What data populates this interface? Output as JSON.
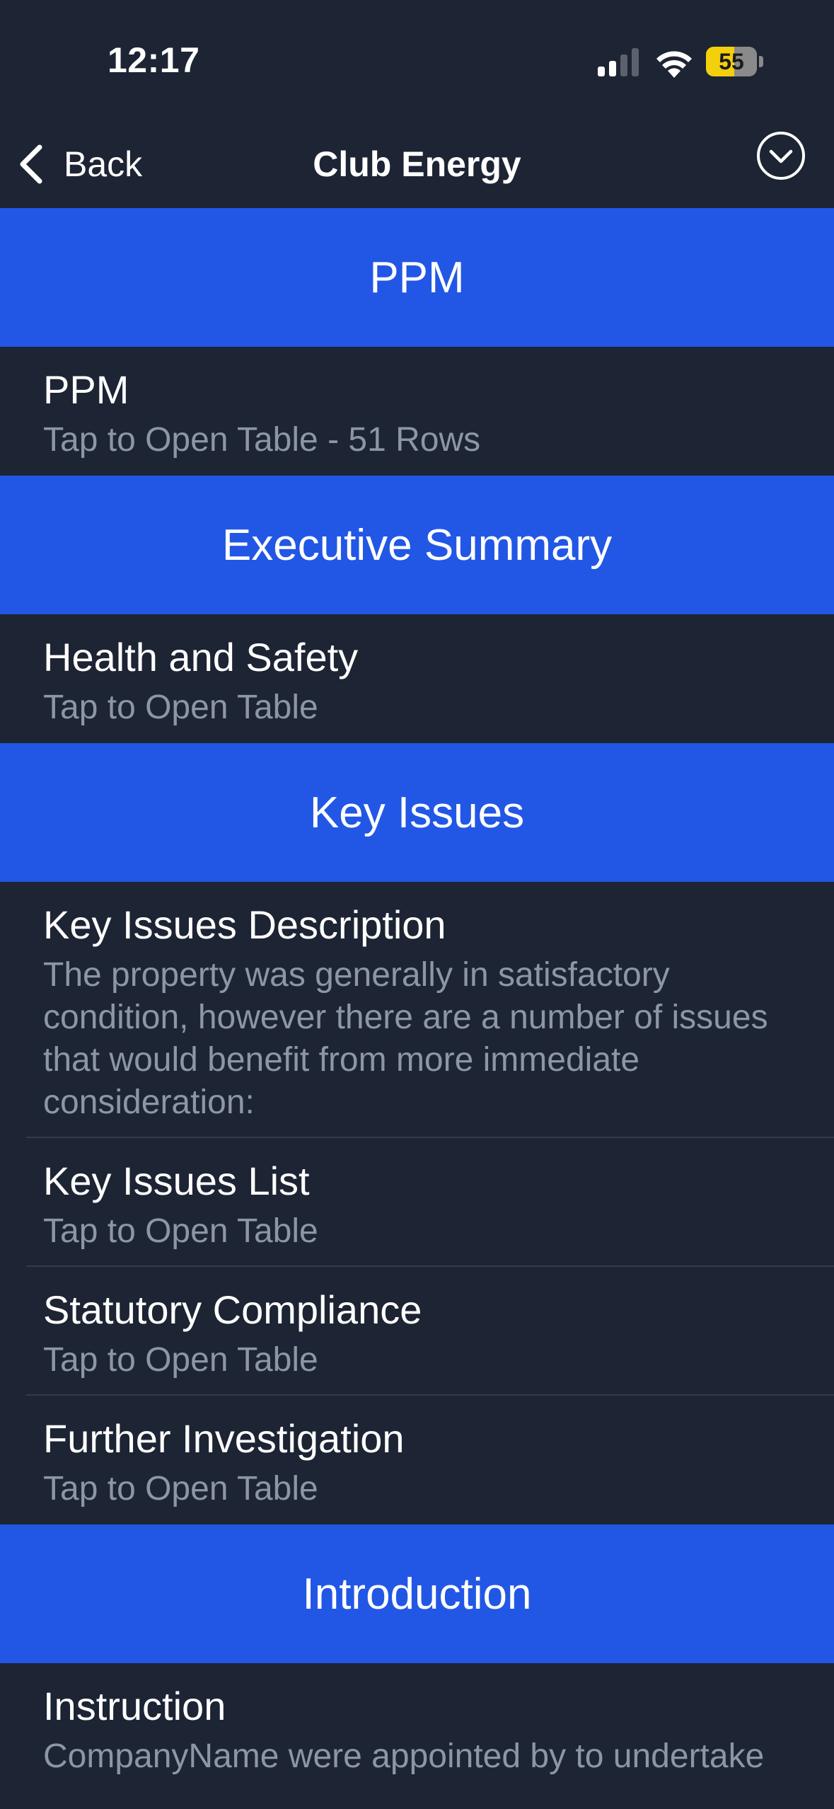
{
  "status_bar": {
    "time": "12:17",
    "battery_percent": "55",
    "battery_level": 0.55
  },
  "nav": {
    "back_label": "Back",
    "title": "Club Energy"
  },
  "sections": [
    {
      "header": "PPM",
      "rows": [
        {
          "title": "PPM",
          "subtitle": "Tap to Open Table - 51 Rows"
        }
      ]
    },
    {
      "header": "Executive Summary",
      "rows": [
        {
          "title": "Health and Safety",
          "subtitle": "Tap to Open Table"
        }
      ]
    },
    {
      "header": "Key Issues",
      "rows": [
        {
          "title": "Key Issues Description",
          "subtitle": "The property was generally in satisfactory condition, however there are a number of issues that would benefit from more immediate consideration:"
        },
        {
          "title": "Key Issues List",
          "subtitle": "Tap to Open Table"
        },
        {
          "title": "Statutory Compliance",
          "subtitle": "Tap to Open Table"
        },
        {
          "title": "Further Investigation",
          "subtitle": "Tap to Open Table"
        }
      ]
    },
    {
      "header": "Introduction",
      "rows": [
        {
          "title": "Instruction",
          "subtitle": "CompanyName were appointed by to undertake"
        }
      ]
    }
  ],
  "colors": {
    "background": "#1d2433",
    "section_header": "#2257e6",
    "subtitle": "#8d96a6",
    "battery": "#f4cf0b"
  }
}
